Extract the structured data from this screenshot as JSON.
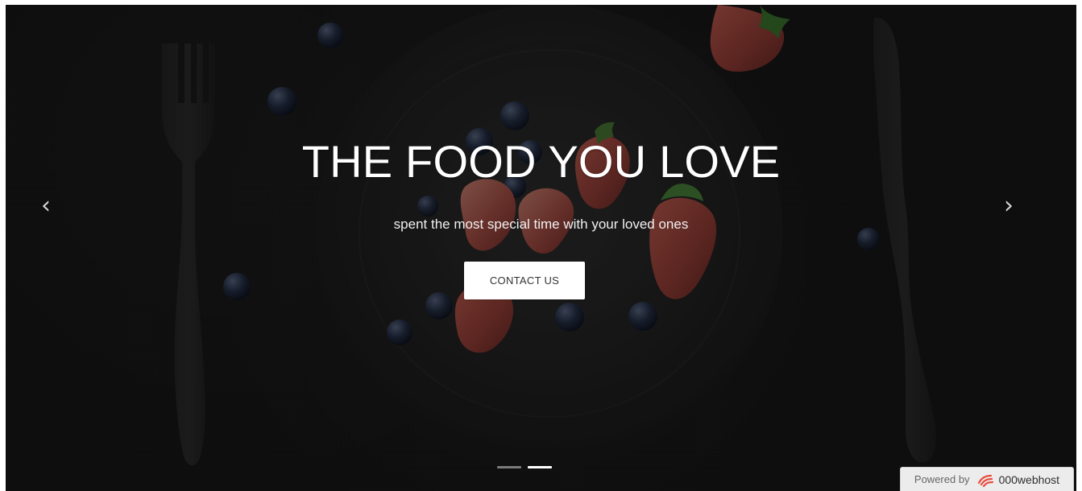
{
  "hero": {
    "title": "THE FOOD YOU LOVE",
    "subtitle": "spent the most special time with your loved ones",
    "button_label": "CONTACT US"
  },
  "carousel": {
    "previous_icon": "‹",
    "next_icon": "›",
    "indicator_count": 2,
    "active_indicator": 2
  },
  "badge": {
    "prefix": "Powered by",
    "brand": "000webhost"
  },
  "colors": {
    "overlay": "#000000",
    "title": "#ffffff",
    "button_background": "#ffffff",
    "badge_background": "#ececec",
    "brand_accent": "#e94d3f"
  },
  "icons": {
    "left_arrow": "chevron-left-icon",
    "right_arrow": "chevron-right-icon",
    "brand_logo": "webhost-logo-icon"
  }
}
